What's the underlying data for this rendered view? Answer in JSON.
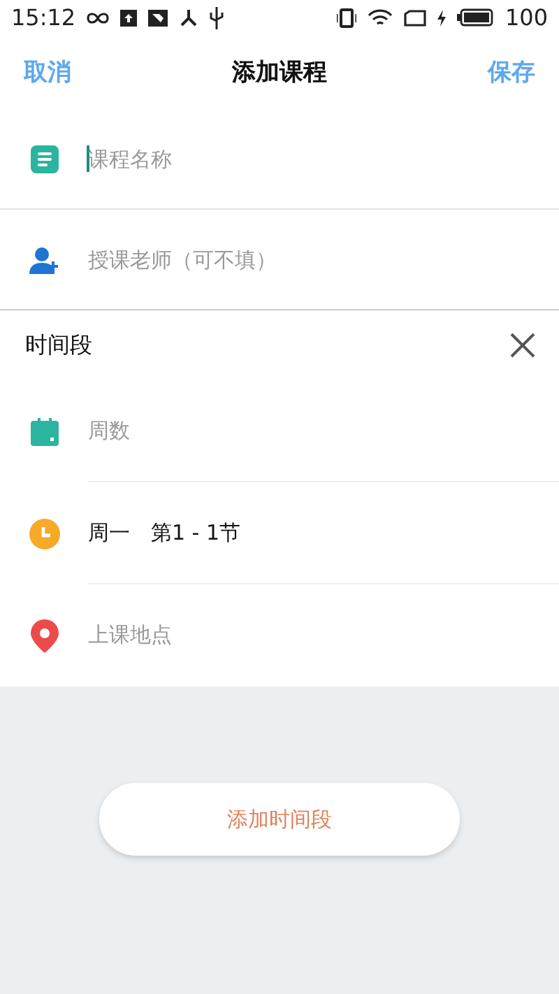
{
  "status_bar": {
    "time": "15:12",
    "battery": "100"
  },
  "header": {
    "cancel": "取消",
    "title": "添加课程",
    "save": "保存"
  },
  "fields": [
    {
      "kind": "course",
      "placeholder": "课程名称",
      "focused": true
    },
    {
      "kind": "teacher",
      "placeholder": "授课老师（可不填）",
      "focused": false
    }
  ],
  "time_slot": {
    "title": "时间段",
    "items": [
      {
        "kind": "week",
        "text": "周数",
        "filled": false
      },
      {
        "kind": "time",
        "text": "周一　第1 - 1节",
        "filled": true
      },
      {
        "kind": "place",
        "text": "上课地点",
        "filled": false
      }
    ]
  },
  "add_button": "添加时间段"
}
